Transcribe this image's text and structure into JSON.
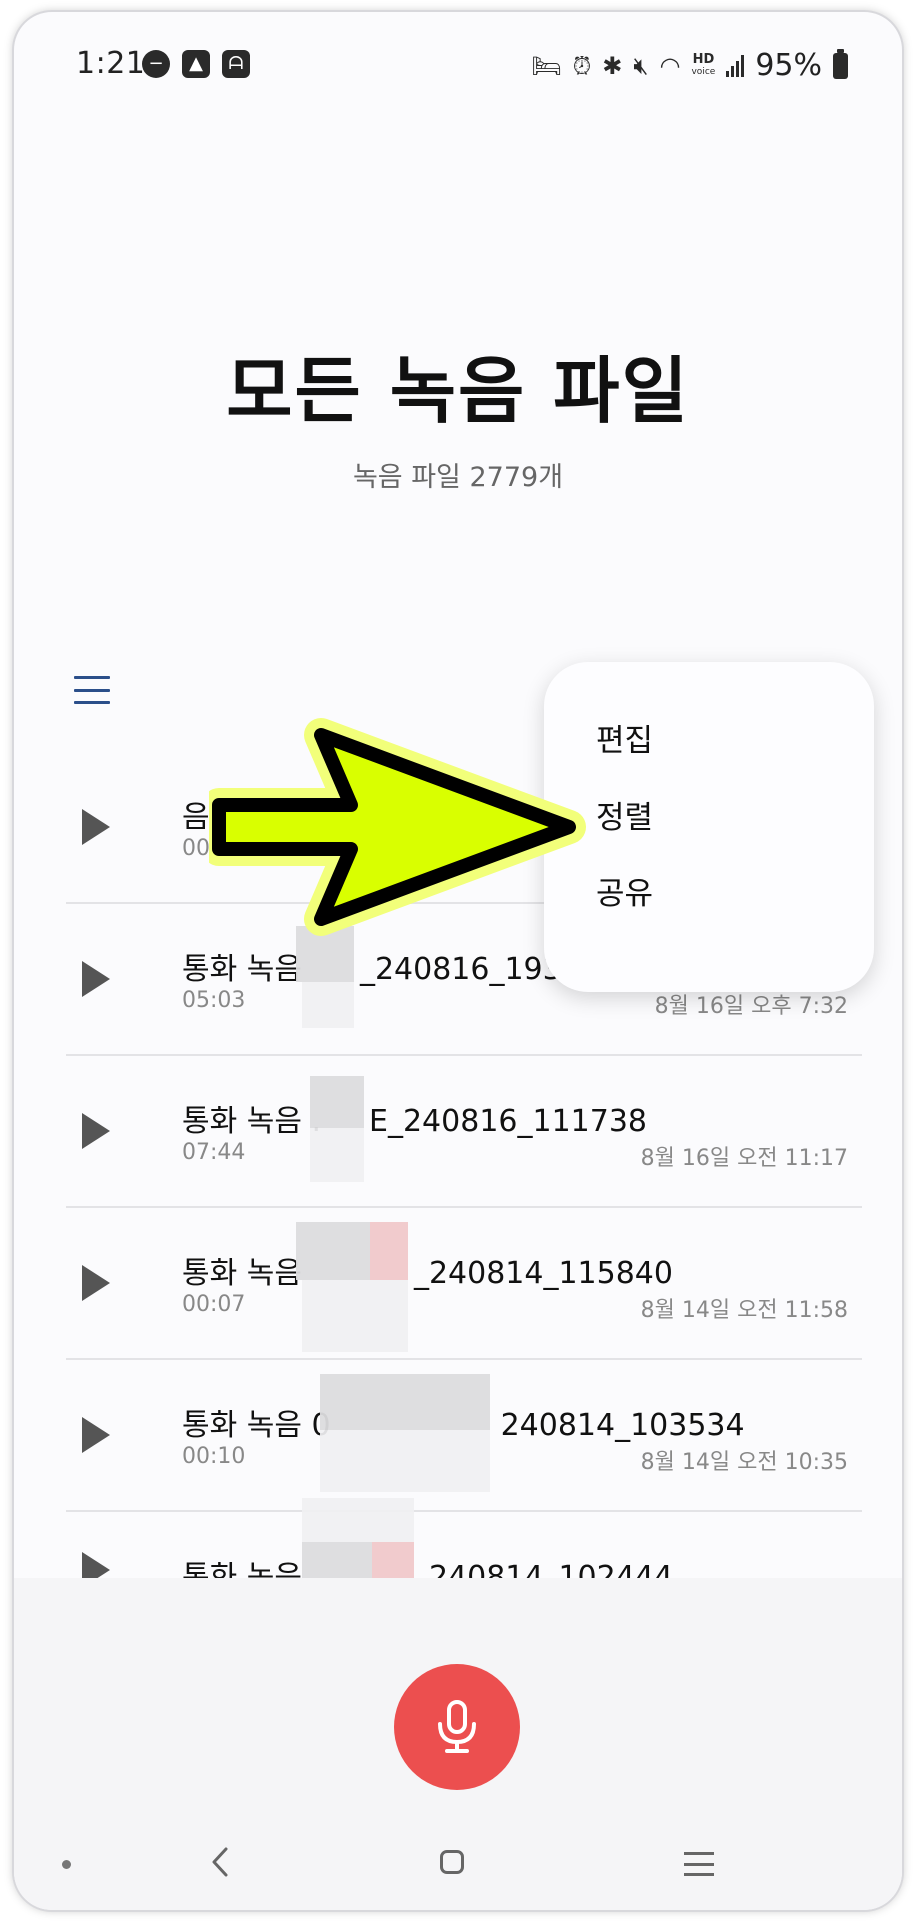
{
  "status_bar": {
    "time": "1:21",
    "left_icons": [
      "do-not-disturb-icon",
      "gallery-icon",
      "app-notification-icon"
    ],
    "right_icons": [
      "sleep-mode-icon",
      "alarm-icon",
      "bluetooth-icon",
      "mute-icon",
      "wifi-icon",
      "hd-voice-icon",
      "signal-icon"
    ],
    "hd_voice_top": "HD",
    "hd_voice_bottom": "voice",
    "battery": "95%"
  },
  "header": {
    "title": "모든 녹음 파일",
    "subtitle": "녹음 파일 2779개"
  },
  "toolbar": {
    "menu_icon": "hamburger-menu-icon"
  },
  "popup_menu": {
    "items": [
      {
        "label": "편집"
      },
      {
        "label": "정렬"
      },
      {
        "label": "공유"
      }
    ]
  },
  "recordings": [
    {
      "name": "음성",
      "duration": "00:06",
      "date": ""
    },
    {
      "name_prefix": "통화 녹음",
      "name_suffix": "_240816_1932",
      "duration": "05:03",
      "date": "8월 16일 오후 7:32"
    },
    {
      "name_prefix": "통화 녹음 .",
      "name_suffix": "E_240816_111738",
      "duration": "07:44",
      "date": "8월 16일 오전 11:17"
    },
    {
      "name_prefix": "통화 녹음",
      "name_suffix": "_240814_115840",
      "duration": "00:07",
      "date": "8월 14일 오전 11:58"
    },
    {
      "name_prefix": "통화 녹음 0",
      "name_suffix": "240814_103534",
      "duration": "00:10",
      "date": "8월 14일 오전 10:35"
    },
    {
      "name_prefix": "통화 녹음",
      "name_suffix": "_240814_102444",
      "duration": "",
      "date": ""
    }
  ],
  "record_button": {
    "icon": "microphone-icon",
    "color": "#ec4f4f"
  },
  "nav_bar": {
    "icons": [
      "nav-dot-icon",
      "back-icon",
      "home-icon",
      "recents-icon"
    ]
  },
  "colors": {
    "accent": "#2b4f8a",
    "annotation_arrow": "#d9ff00"
  }
}
